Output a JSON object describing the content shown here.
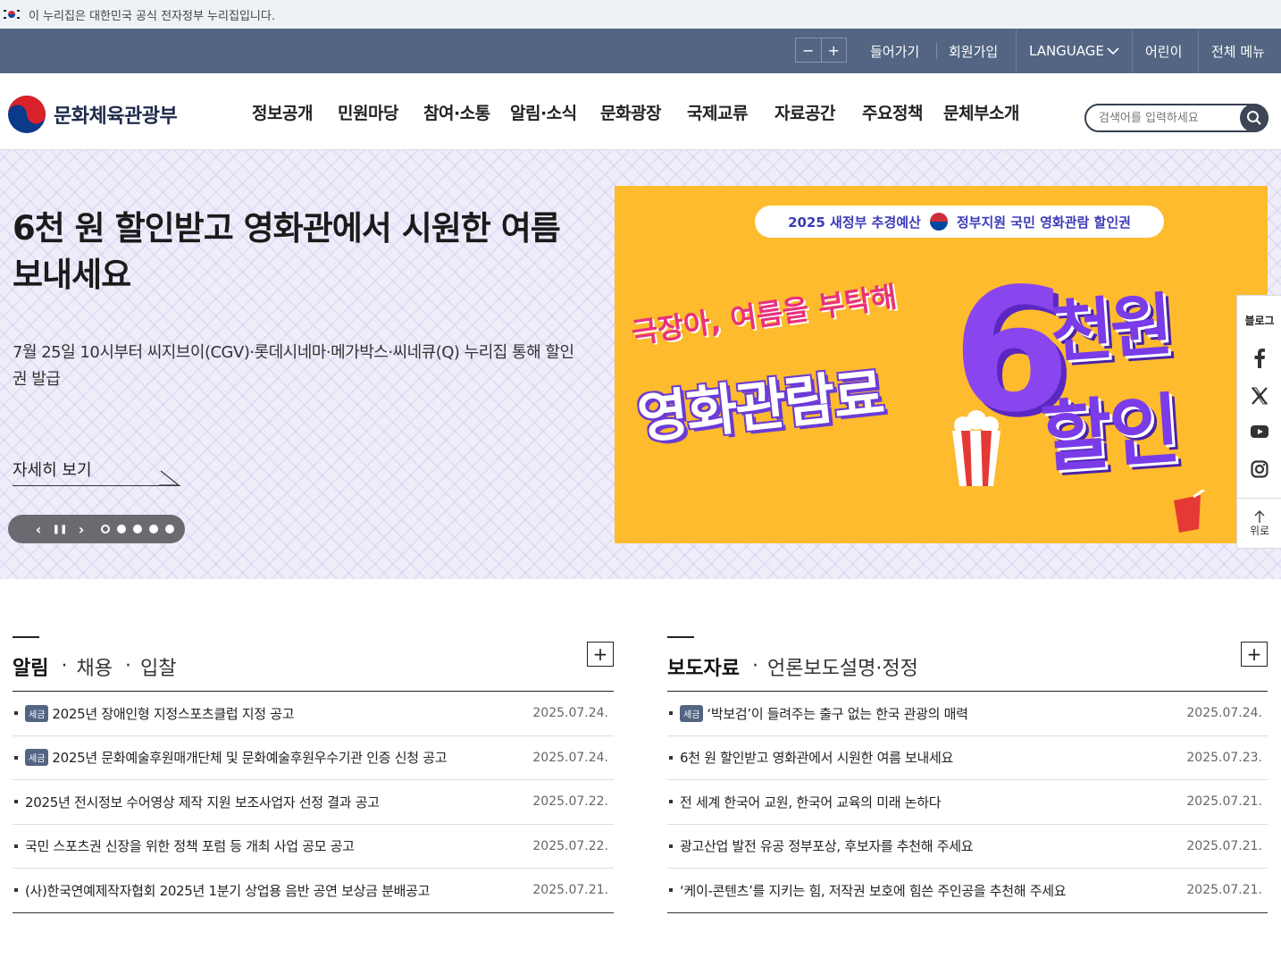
{
  "gov_banner": {
    "text": "이 누리집은 대한민국 공식 전자정부 누리집입니다."
  },
  "util": {
    "zoom_out": "−",
    "zoom_in": "+",
    "login": "들어가기",
    "signup": "회원가입",
    "language": "LANGUAGE",
    "kids": "어린이",
    "all_menu": "전체 메뉴"
  },
  "header": {
    "logo_text": "문화체육관광부",
    "nav": [
      "정보공개",
      "민원마당",
      "참여·소통",
      "알림·소식",
      "문화광장",
      "국제교류",
      "자료공간",
      "주요정책",
      "문체부소개"
    ],
    "search_placeholder": "검색어를 입력하세요"
  },
  "hero": {
    "title": "6천 원 할인받고 영화관에서 시원한 여름 보내세요",
    "desc": "7월 25일 10시부터 씨지브이(CGV)·롯데시네마·메가박스·씨네큐(Q) 누리집 통해 할인권 발급",
    "more": "자세히 보기",
    "pager": {
      "prev": "‹",
      "pause": "❚❚",
      "next": "›"
    },
    "slide_count": 5,
    "active_slide": 1,
    "banner": {
      "pill_left": "2025 새정부 추경예산",
      "pill_right": "정부지원 국민 영화관람 할인권",
      "slogan": "극장아, 여름을 부탁해",
      "main": "영화관람료",
      "six": "6",
      "won": "천원",
      "discount": "할인"
    }
  },
  "sns": {
    "blog": "블로그",
    "top": "위로"
  },
  "board_left": {
    "tabs": [
      "알림",
      "채용",
      "입찰"
    ],
    "more": "+",
    "items": [
      {
        "badge": "세금",
        "title": "2025년 장애인형 지정스포츠클럽 지정 공고",
        "date": "2025.07.24."
      },
      {
        "badge": "세금",
        "title": "2025년 문화예술후원매개단체 및 문화예술후원우수기관 인증 신청 공고",
        "date": "2025.07.24."
      },
      {
        "badge": "",
        "title": "2025년 전시정보 수어영상 제작 지원 보조사업자 선정 결과 공고",
        "date": "2025.07.22."
      },
      {
        "badge": "",
        "title": "국민 스포츠권 신장을 위한 정책 포럼 등 개최 사업 공모 공고",
        "date": "2025.07.22."
      },
      {
        "badge": "",
        "title": "(사)한국연예제작자협회 2025년 1분기 상업용 음반 공연 보상금 분배공고",
        "date": "2025.07.21."
      }
    ]
  },
  "board_right": {
    "tabs": [
      "보도자료",
      "언론보도설명·정정"
    ],
    "more": "+",
    "items": [
      {
        "badge": "세금",
        "title": "‘박보검’이 들려주는 출구 없는 한국 관광의 매력",
        "date": "2025.07.24."
      },
      {
        "badge": "",
        "title": "6천 원 할인받고 영화관에서 시원한 여름 보내세요",
        "date": "2025.07.23."
      },
      {
        "badge": "",
        "title": "전 세계 한국어 교원, 한국어 교육의 미래 논하다",
        "date": "2025.07.21."
      },
      {
        "badge": "",
        "title": "광고산업 발전 유공 정부포상, 후보자를 추천해 주세요",
        "date": "2025.07.21."
      },
      {
        "badge": "",
        "title": "‘케이-콘텐츠’를 지키는 힘, 저작권 보호에 힘쓴 주인공을 추천해 주세요",
        "date": "2025.07.21."
      }
    ]
  }
}
